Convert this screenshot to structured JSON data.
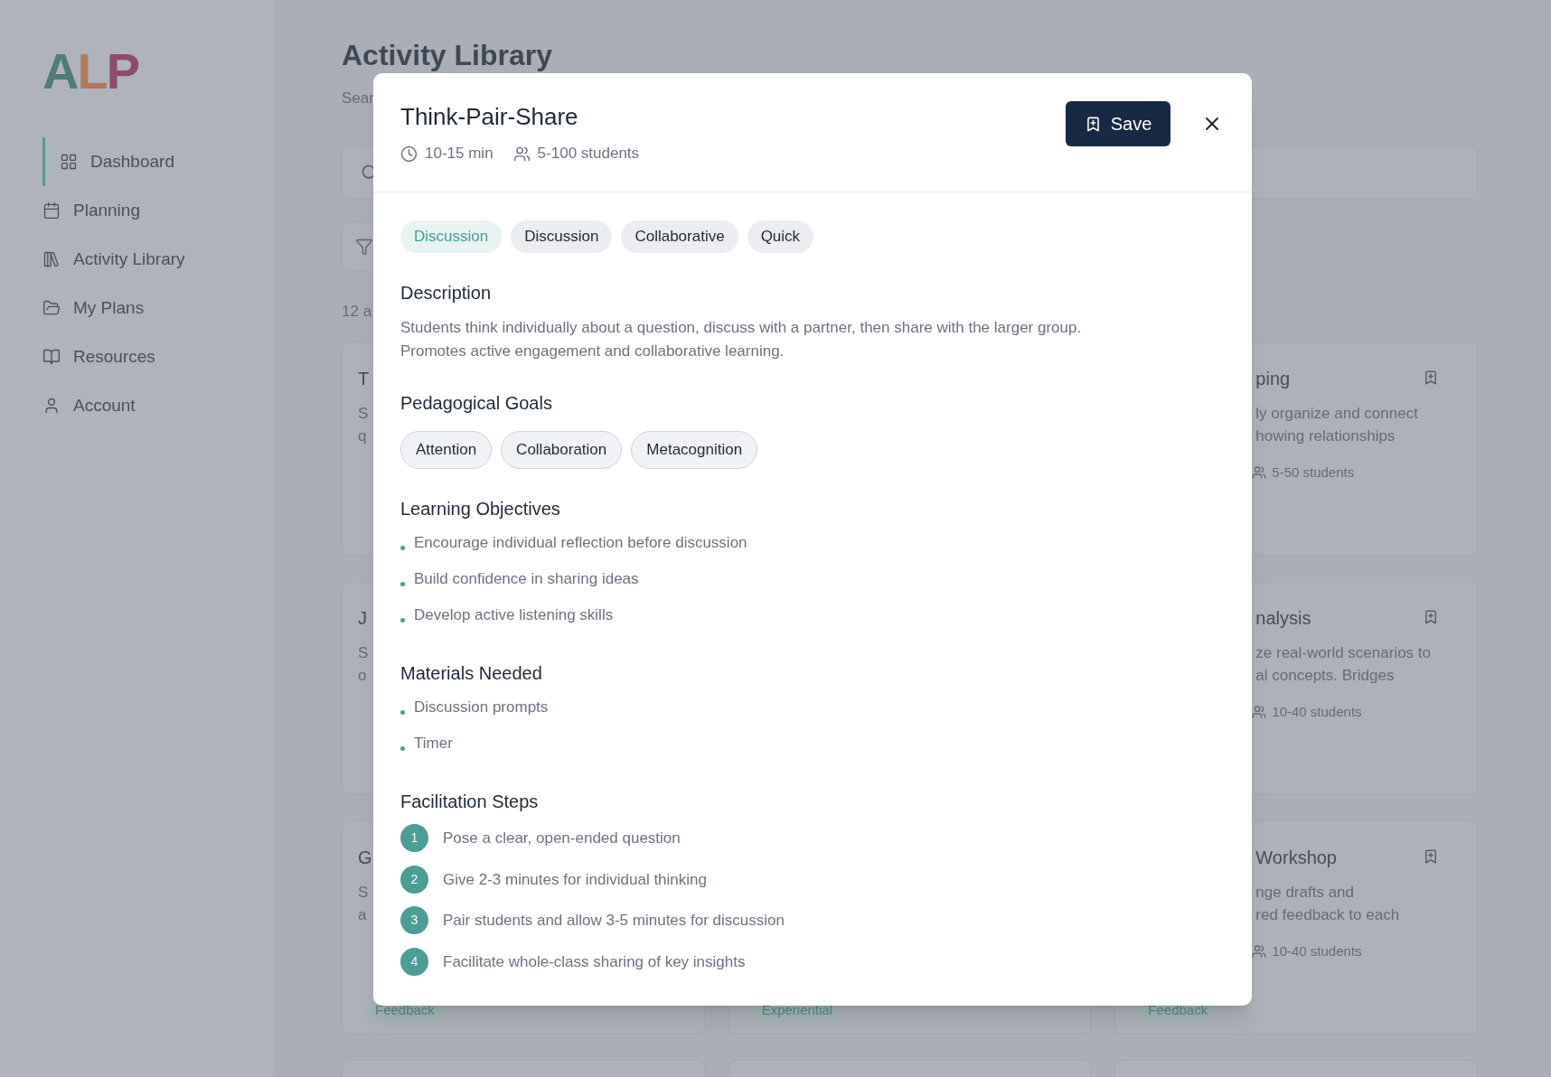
{
  "sidebar": {
    "logo": [
      {
        "letter": "A",
        "color": "#4f7b7b"
      },
      {
        "letter": "L",
        "color": "#b27a5d"
      },
      {
        "letter": "P",
        "color": "#8e4a6f"
      }
    ],
    "nav": [
      {
        "label": "Dashboard",
        "selected": true
      },
      {
        "label": "Planning",
        "selected": false
      },
      {
        "label": "Activity Library",
        "selected": false
      },
      {
        "label": "My Plans",
        "selected": false
      },
      {
        "label": "Resources",
        "selected": false
      },
      {
        "label": "Account",
        "selected": false
      }
    ]
  },
  "page": {
    "title": "Activity Library",
    "subtitle": "Sear",
    "count": "12 a"
  },
  "cards": [
    {
      "kind": "left",
      "title": "T",
      "description": [
        "S",
        "q"
      ]
    },
    {
      "kind": "right",
      "title": "ping",
      "description": [
        "ly organize and connect",
        "howing relationships"
      ],
      "students": "5-50 students"
    },
    {
      "kind": "left",
      "title": "J",
      "description": [
        "S",
        "o"
      ]
    },
    {
      "kind": "right",
      "title": "nalysis",
      "description": [
        "ze real-world scenarios to",
        "al concepts. Bridges"
      ],
      "students": "10-40 students"
    },
    {
      "kind": "left",
      "title": "G",
      "description": [
        "S",
        "a"
      ],
      "tag": "Feedback"
    },
    {
      "kind": "middle",
      "tag": "Experiential"
    },
    {
      "kind": "right",
      "title": "Workshop",
      "description": [
        "nge drafts and",
        "red feedback to each"
      ],
      "students": "10-40 students",
      "tag": "Feedback"
    }
  ],
  "modal": {
    "title": "Think-Pair-Share",
    "duration": "10-15 min",
    "students": "5-100 students",
    "save": "Save",
    "tags": [
      {
        "label": "Discussion",
        "kind": "category"
      },
      {
        "label": "Discussion",
        "kind": "tag"
      },
      {
        "label": "Collaborative",
        "kind": "tag"
      },
      {
        "label": "Quick",
        "kind": "tag"
      }
    ],
    "sections": [
      {
        "heading": "Description",
        "kind": "text",
        "lines": [
          "Students think individually about a question, discuss with a partner, then share with the larger group.",
          "Promotes active engagement and collaborative learning."
        ]
      },
      {
        "heading": "Pedagogical Goals",
        "kind": "pills",
        "items": [
          "Attention",
          "Collaboration",
          "Metacognition"
        ]
      },
      {
        "heading": "Learning Objectives",
        "kind": "bullets",
        "items": [
          "Encourage individual reflection before discussion",
          "Build confidence in sharing ideas",
          "Develop active listening skills"
        ]
      },
      {
        "heading": "Materials Needed",
        "kind": "bullets",
        "items": [
          "Discussion prompts",
          "Timer"
        ]
      },
      {
        "heading": "Facilitation Steps",
        "kind": "steps",
        "items": [
          {
            "number": "1",
            "text": "Pose a clear, open-ended question"
          },
          {
            "number": "2",
            "text": "Give 2-3 minutes for individual thinking"
          },
          {
            "number": "3",
            "text": "Pair students and allow 3-5 minutes for discussion"
          },
          {
            "number": "4",
            "text": "Facilitate whole-class sharing of key insights"
          }
        ]
      }
    ]
  }
}
